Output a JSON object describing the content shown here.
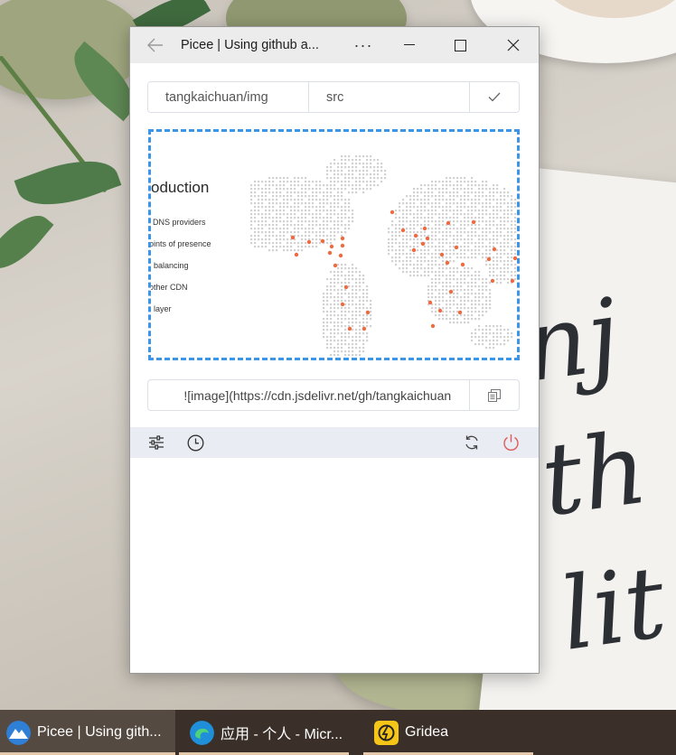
{
  "window": {
    "title": "Picee | Using github a...",
    "more_label": "···",
    "colors": {
      "accent": "#3b95e8",
      "power": "#e05a5a",
      "toolbar_bg": "#e9ecf2"
    }
  },
  "upload_form": {
    "repo_value": "tangkaichuan/img",
    "path_value": "src",
    "confirm_icon": "check-icon"
  },
  "preview": {
    "heading": "oduction",
    "items": [
      "DNS providers",
      "oints of presence",
      "balancing",
      "other CDN",
      "layer"
    ],
    "marker_color": "#f06a3f"
  },
  "result": {
    "link_text": "![image](https://cdn.jsdelivr.net/gh/tangkaichuan",
    "copy_icon": "copy-icon"
  },
  "toolbar": {
    "left_icons": [
      "settings-sliders-icon",
      "history-clock-icon"
    ],
    "right_icons": [
      "refresh-icon",
      "power-icon"
    ]
  },
  "taskbar": {
    "items": [
      {
        "label": "Picee | Using gith...",
        "icon": "picee-app-icon",
        "active": true
      },
      {
        "label": "应用 - 个人 - Micr...",
        "icon": "edge-browser-icon",
        "active": false
      },
      {
        "label": "Gridea",
        "icon": "gridea-app-icon",
        "active": false
      }
    ]
  }
}
